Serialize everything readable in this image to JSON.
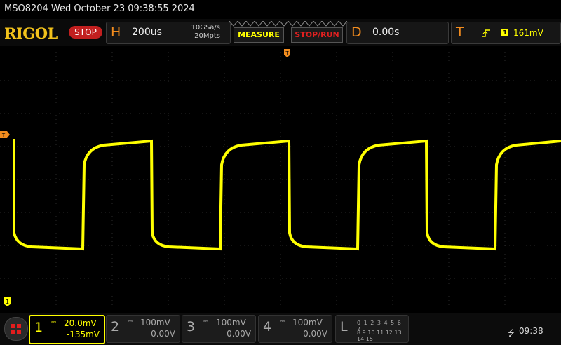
{
  "title": "MSO8204  Wed October 23 09:38:55 2024",
  "toolbar": {
    "logo": "RIGOL",
    "run_state": "STOP",
    "horizontal": {
      "letter": "H",
      "timebase": "200us",
      "sample_rate": "10GSa/s",
      "memory_depth": "20Mpts"
    },
    "measure_label": "MEASURE",
    "stoprun_label": "STOP/RUN",
    "delay": {
      "letter": "D",
      "value": "0.00s"
    },
    "trigger": {
      "letter": "T",
      "slope_icon": "rising-edge-icon",
      "source": "1",
      "level": "161mV"
    }
  },
  "markers": {
    "trigger_pos": "T",
    "trigger_level": "T",
    "ch1_ground": "1"
  },
  "channels": [
    {
      "num": "1",
      "coupling": "DC",
      "scale": "20.0mV",
      "offset": "-135mV",
      "color": "#ffff00",
      "active": true
    },
    {
      "num": "2",
      "coupling": "DC",
      "scale": "100mV",
      "offset": "0.00V",
      "active": false
    },
    {
      "num": "3",
      "coupling": "DC",
      "scale": "100mV",
      "offset": "0.00V",
      "active": false
    },
    {
      "num": "4",
      "coupling": "DC",
      "scale": "100mV",
      "offset": "0.00V",
      "active": false
    }
  ],
  "logic": {
    "label": "L",
    "row1": "0 1 2 3 4 5 6 7",
    "row2": "8 9 10 11 12 13 14 15"
  },
  "status": {
    "usb_icon": "usb-icon",
    "time": "09:38"
  },
  "waveform": {
    "type": "square",
    "color": "#ffff00",
    "periods_visible": 4.1
  }
}
